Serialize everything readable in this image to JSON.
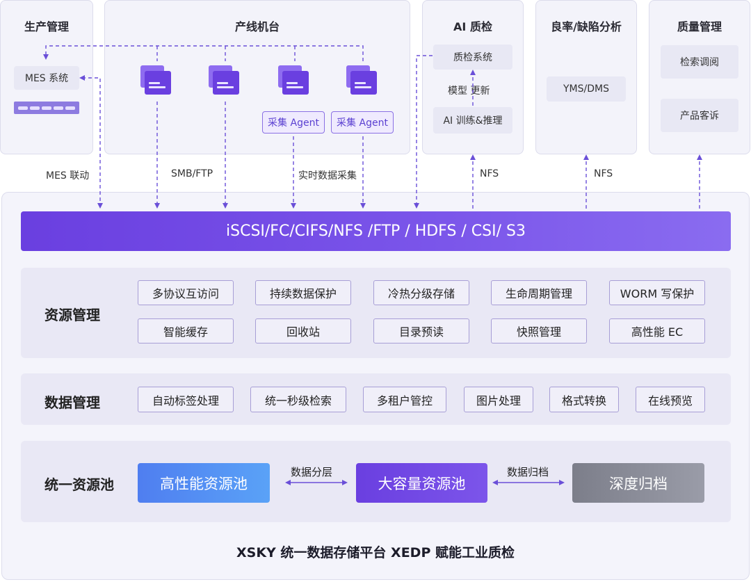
{
  "panels": {
    "production": {
      "title": "生产管理",
      "mes": "MES 系统"
    },
    "line": {
      "title": "产线机台",
      "agent": "采集 Agent"
    },
    "ai": {
      "title": "AI 质检",
      "system": "质检系统",
      "update": "模型  更新",
      "training": "AI 训练&推理"
    },
    "yield": {
      "title": "良率/缺陷分析",
      "yms": "YMS/DMS"
    },
    "quality": {
      "title": "质量管理",
      "search": "检索调阅",
      "complaint": "产品客诉"
    }
  },
  "connections": {
    "mes_link": "MES 联动",
    "smb": "SMB/FTP",
    "realtime": "实时数据采集",
    "nfs": "NFS"
  },
  "protocols": "iSCSI/FC/CIFS/NFS /FTP / HDFS / CSI/ S3",
  "resource": {
    "title": "资源管理",
    "row1": [
      "多协议互访问",
      "持续数据保护",
      "冷热分级存储",
      "生命周期管理",
      "WORM 写保护"
    ],
    "row2": [
      "智能缓存",
      "回收站",
      "目录预读",
      "快照管理",
      "高性能 EC"
    ]
  },
  "data_mgmt": {
    "title": "数据管理",
    "items": [
      "自动标签处理",
      "统一秒级检索",
      "多租户管控",
      "图片处理",
      "格式转换",
      "在线预览"
    ]
  },
  "pool": {
    "title": "统一资源池",
    "high": "高性能资源池",
    "large": "大容量资源池",
    "archive": "深度归档",
    "tiering": "数据分层",
    "archiving": "数据归档"
  },
  "footer": "XSKY 统一数据存储平台 XEDP 赋能工业质检",
  "colors": {
    "accent": "#6a3fe0",
    "high_pool": "#4f8ef5",
    "archive": "#8a8c98",
    "agent_border": "#8a70e4"
  },
  "icons": [
    "machine-icon",
    "server-rack-icon"
  ]
}
